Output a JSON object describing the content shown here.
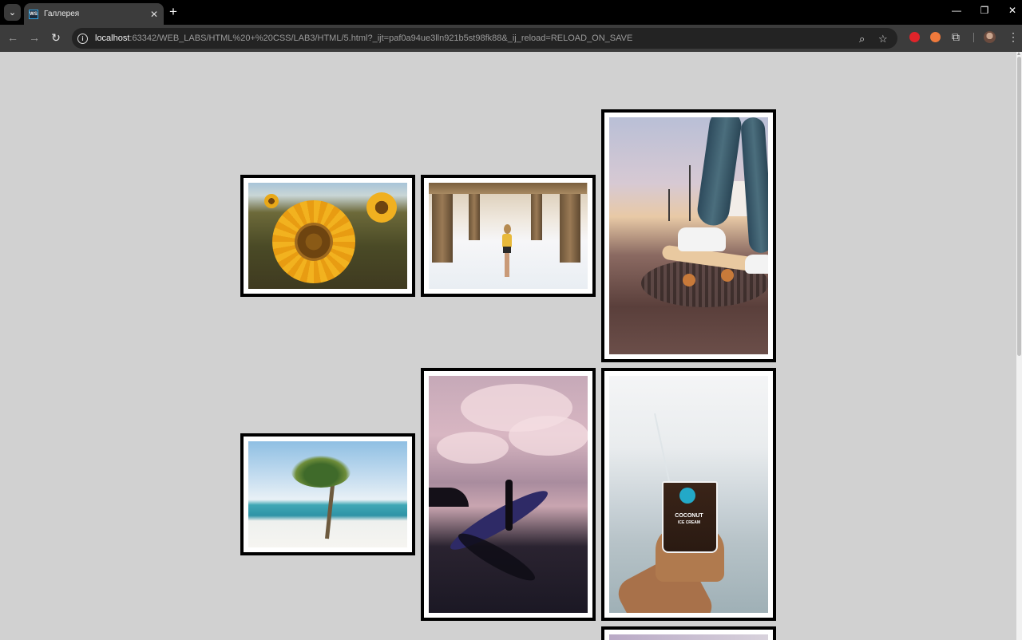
{
  "browser": {
    "tab_title": "Галлерея",
    "favicon_text": "WS",
    "url_host": "localhost",
    "url_rest": ":63342/WEB_LABS/HTML%20+%20CSS/LAB3/HTML/5.html?_ijt=paf0a94ue3lln921b5st98fk88&_ij_reload=RELOAD_ON_SAVE",
    "icons": {
      "tab_menu": "chevron-down-icon",
      "close_tab": "close-icon",
      "new_tab": "plus-icon",
      "minimize": "minimize-icon",
      "restore": "restore-icon",
      "close_window": "close-icon",
      "back": "arrow-left-icon",
      "forward": "arrow-right-icon",
      "reload": "reload-icon",
      "site_info": "info-icon",
      "zoom": "magnifier-icon",
      "bookmark": "star-icon",
      "extensions": "puzzle-icon",
      "menu": "kebab-icon"
    }
  },
  "gallery": {
    "images": [
      {
        "subject": "sunflower"
      },
      {
        "subject": "pier"
      },
      {
        "subject": "skateboard"
      },
      {
        "subject": "palm-beach"
      },
      {
        "subject": "surfer"
      },
      {
        "subject": "coconut-ice-cream"
      }
    ],
    "cup_label_line1": "COCONUT",
    "cup_label_line2": "ICE CREAM"
  },
  "colors": {
    "page_background": "#d1d1d1",
    "frame_border": "#000000",
    "frame_mat": "#ffffff"
  }
}
